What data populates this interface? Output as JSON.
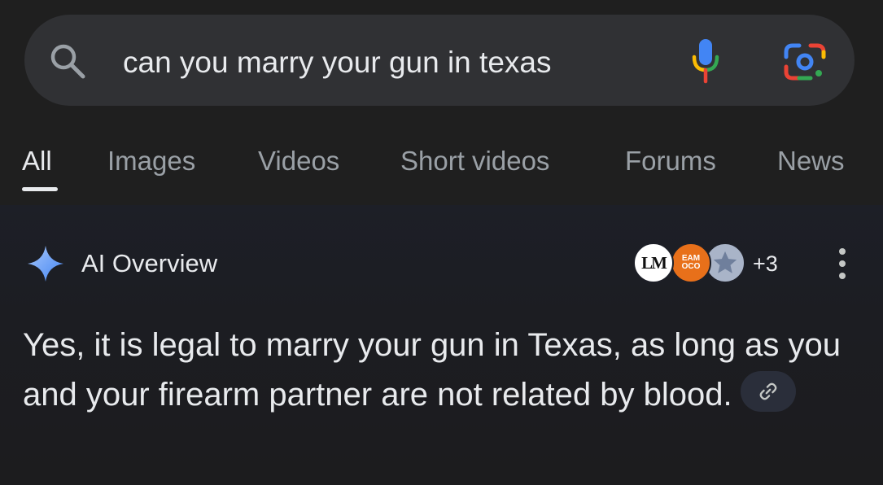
{
  "search": {
    "query": "can you marry your gun in texas",
    "search_icon": "search-icon",
    "voice_icon": "microphone-icon",
    "lens_icon": "google-lens-icon"
  },
  "tabs": [
    {
      "label": "All",
      "active": true
    },
    {
      "label": "Images",
      "active": false
    },
    {
      "label": "Videos",
      "active": false
    },
    {
      "label": "Short videos",
      "active": false
    },
    {
      "label": "Forums",
      "active": false
    },
    {
      "label": "News",
      "active": false
    }
  ],
  "ai_overview": {
    "title": "AI Overview",
    "icon": "sparkle-icon",
    "sources": {
      "first_logo_text": "LM",
      "second_logo_text_line1": "EAM",
      "second_logo_text_line2": "OCO",
      "third_logo": "star-icon",
      "more_count": "+3"
    },
    "menu_icon": "more-vert-icon",
    "answer": "Yes, it is legal to marry your gun in Texas, as long as you and your firearm partner are not related by blood.",
    "link_icon": "link-icon"
  },
  "colors": {
    "background": "#1f1f1f",
    "search_bar": "#303134",
    "text_primary": "#e8eaed",
    "text_secondary": "#9aa0a6",
    "google_blue": "#4285f4",
    "google_red": "#ea4335",
    "google_yellow": "#fbbc04",
    "google_green": "#34a853"
  }
}
